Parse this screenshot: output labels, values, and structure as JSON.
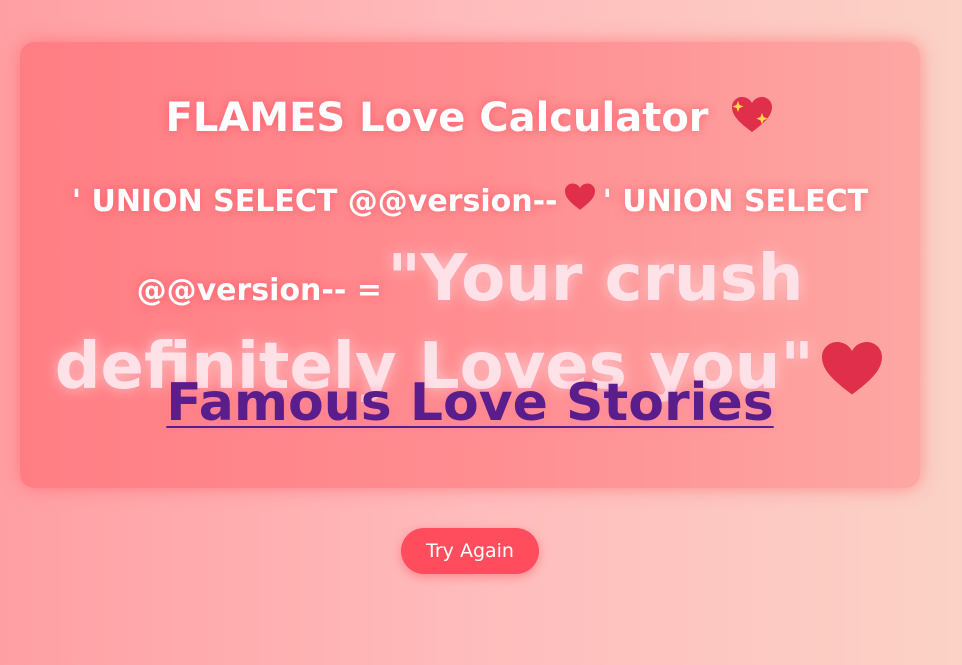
{
  "card": {
    "title": "FLAMES Love Calculator",
    "title_icon": "sparkling-heart-icon",
    "names_part1": "' UNION SELECT @@version--",
    "names_separator_icon": "heart-icon",
    "names_part2": "' UNION SELECT @@version-- =",
    "verdict": "\"Your crush definitely Loves you\"",
    "verdict_icon": "heart-icon",
    "stories_link": "Famous Love Stories"
  },
  "actions": {
    "try_again_label": "Try Again"
  },
  "colors": {
    "heart": "#e02f4a",
    "link": "#5a1d8c",
    "button": "#ff4d5e"
  }
}
